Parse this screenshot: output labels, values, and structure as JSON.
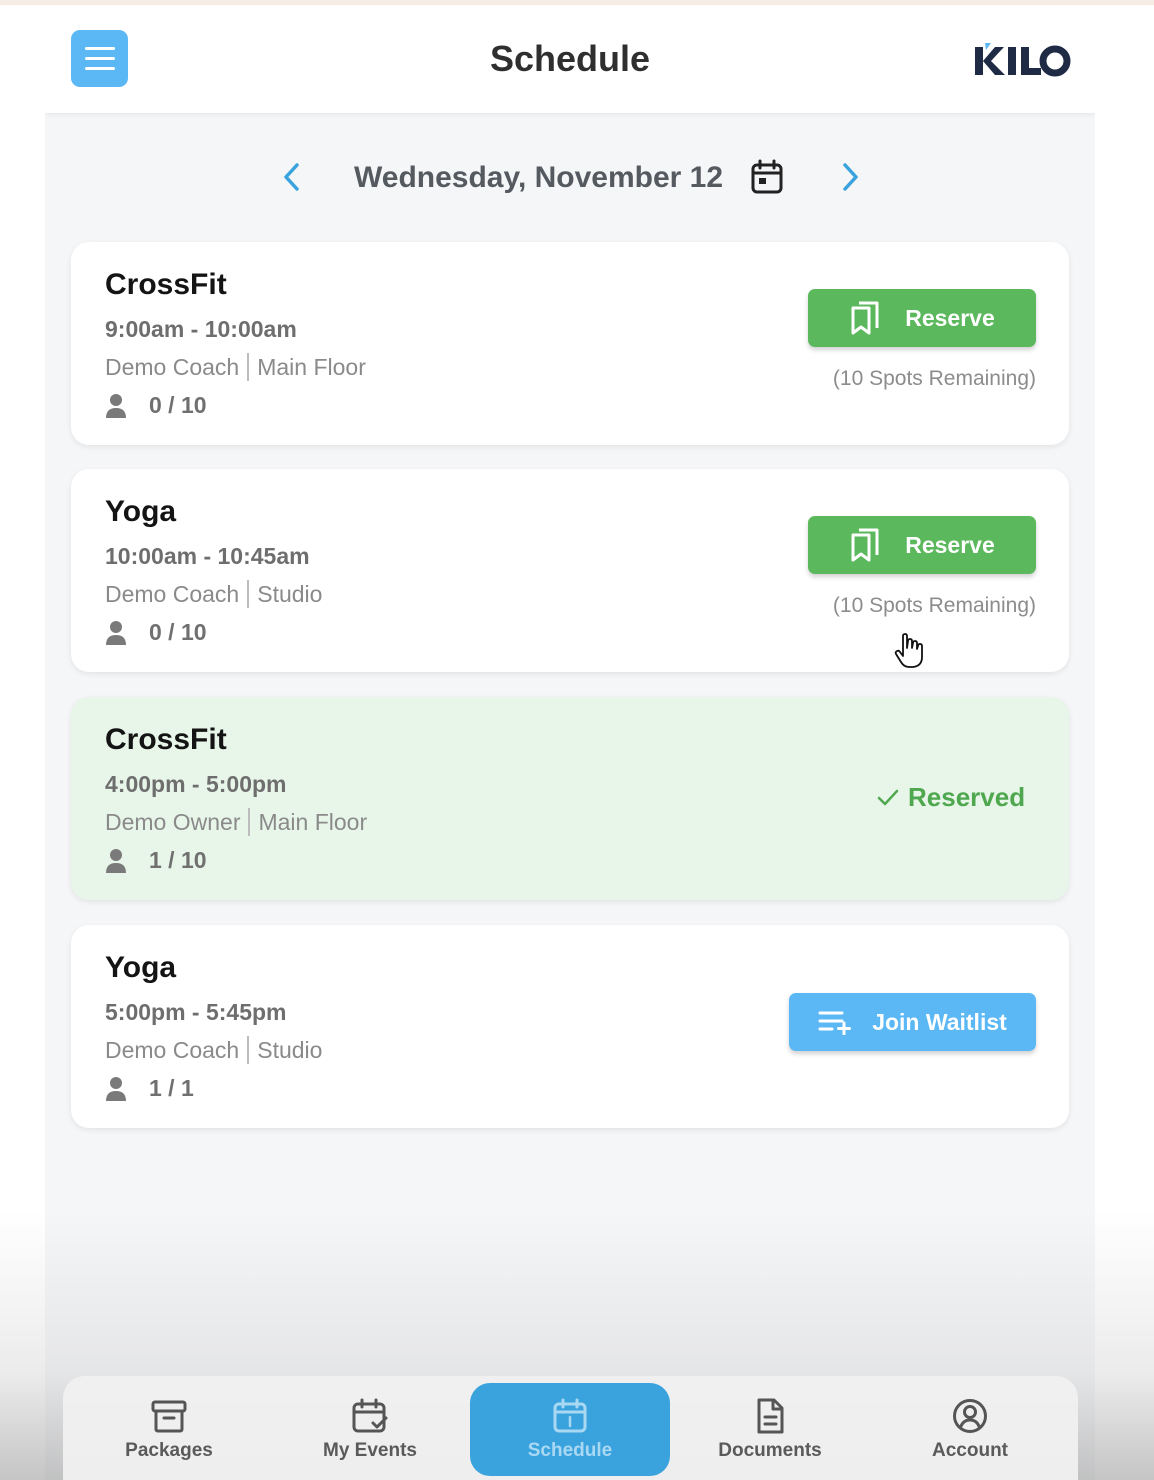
{
  "header": {
    "title": "Schedule",
    "logo_text": "KILO"
  },
  "date_nav": {
    "date": "Wednesday, November 12"
  },
  "classes": [
    {
      "title": "CrossFit",
      "time": "9:00am - 10:00am",
      "coach": "Demo Coach",
      "location": "Main Floor",
      "count": "0 / 10",
      "action": "reserve",
      "action_label": "Reserve",
      "spots": "(10 Spots Remaining)"
    },
    {
      "title": "Yoga",
      "time": "10:00am - 10:45am",
      "coach": "Demo Coach",
      "location": "Studio",
      "count": "0 / 10",
      "action": "reserve",
      "action_label": "Reserve",
      "spots": "(10 Spots Remaining)"
    },
    {
      "title": "CrossFit",
      "time": "4:00pm - 5:00pm",
      "coach": "Demo Owner",
      "location": "Main Floor",
      "count": "1 / 10",
      "action": "reserved",
      "action_label": "Reserved"
    },
    {
      "title": "Yoga",
      "time": "5:00pm - 5:45pm",
      "coach": "Demo Coach",
      "location": "Studio",
      "count": "1 / 1",
      "action": "waitlist",
      "action_label": "Join Waitlist"
    }
  ],
  "tabbar": {
    "items": [
      {
        "label": "Packages",
        "icon": "archive-box-icon"
      },
      {
        "label": "My Events",
        "icon": "calendar-check-icon"
      },
      {
        "label": "Schedule",
        "icon": "calendar-day-icon",
        "active": true
      },
      {
        "label": "Documents",
        "icon": "document-icon"
      },
      {
        "label": "Account",
        "icon": "user-circle-icon"
      }
    ]
  },
  "colors": {
    "accent_blue": "#5bb8f5",
    "reserve_green": "#5cb85c",
    "reserved_bg": "#e8f6ea",
    "active_tab": "#3aa3de"
  }
}
